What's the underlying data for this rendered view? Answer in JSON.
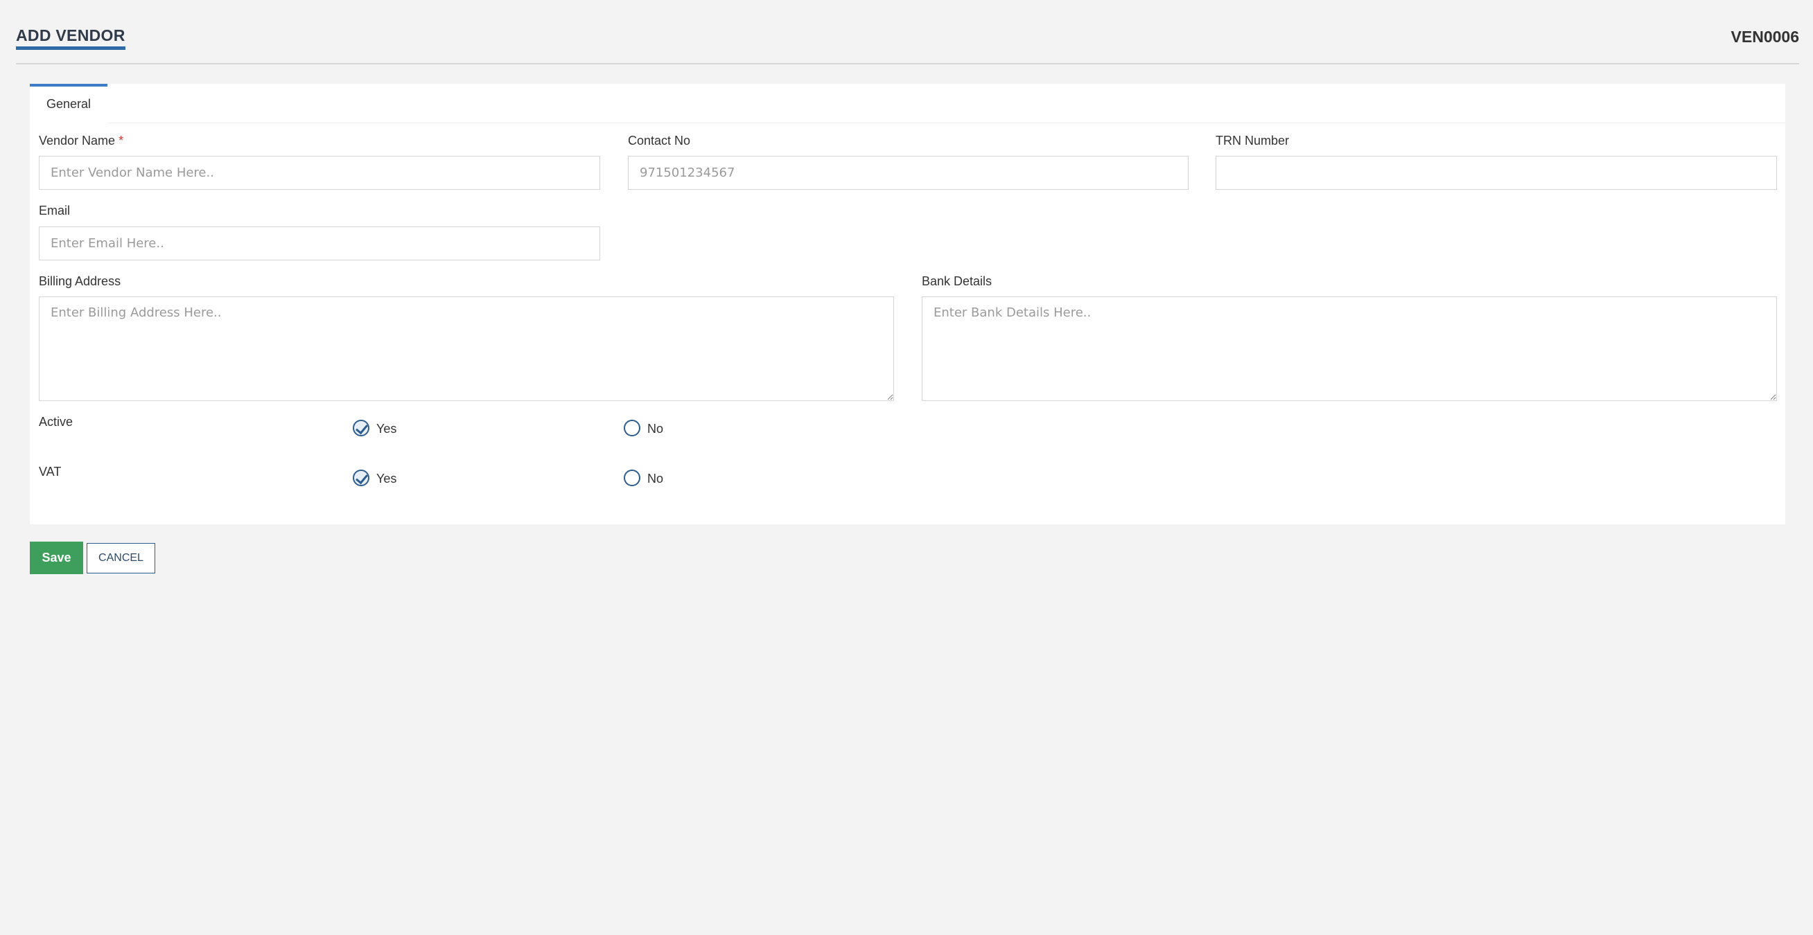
{
  "header": {
    "title": "ADD VENDOR",
    "code": "VEN0006"
  },
  "tabs": [
    {
      "label": "General",
      "active": true
    }
  ],
  "form": {
    "vendor_name": {
      "label": "Vendor Name",
      "required_mark": "*",
      "value": "",
      "placeholder": "Enter Vendor Name Here.."
    },
    "contact_no": {
      "label": "Contact No",
      "value": "",
      "placeholder": "971501234567"
    },
    "trn_number": {
      "label": "TRN Number",
      "value": "",
      "placeholder": ""
    },
    "email": {
      "label": "Email",
      "value": "",
      "placeholder": "Enter Email Here.."
    },
    "billing_address": {
      "label": "Billing Address",
      "value": "",
      "placeholder": "Enter Billing Address Here.."
    },
    "bank_details": {
      "label": "Bank Details",
      "value": "",
      "placeholder": "Enter Bank Details Here.."
    },
    "active": {
      "label": "Active",
      "yes_label": "Yes",
      "no_label": "No",
      "selected": "Yes"
    },
    "vat": {
      "label": "VAT",
      "yes_label": "Yes",
      "no_label": "No",
      "selected": "Yes"
    }
  },
  "buttons": {
    "save_label": "Save",
    "cancel_label": "CANCEL"
  },
  "colors": {
    "accent": "#2d6aa6",
    "save": "#3e9f5c",
    "required": "#dd3333"
  }
}
